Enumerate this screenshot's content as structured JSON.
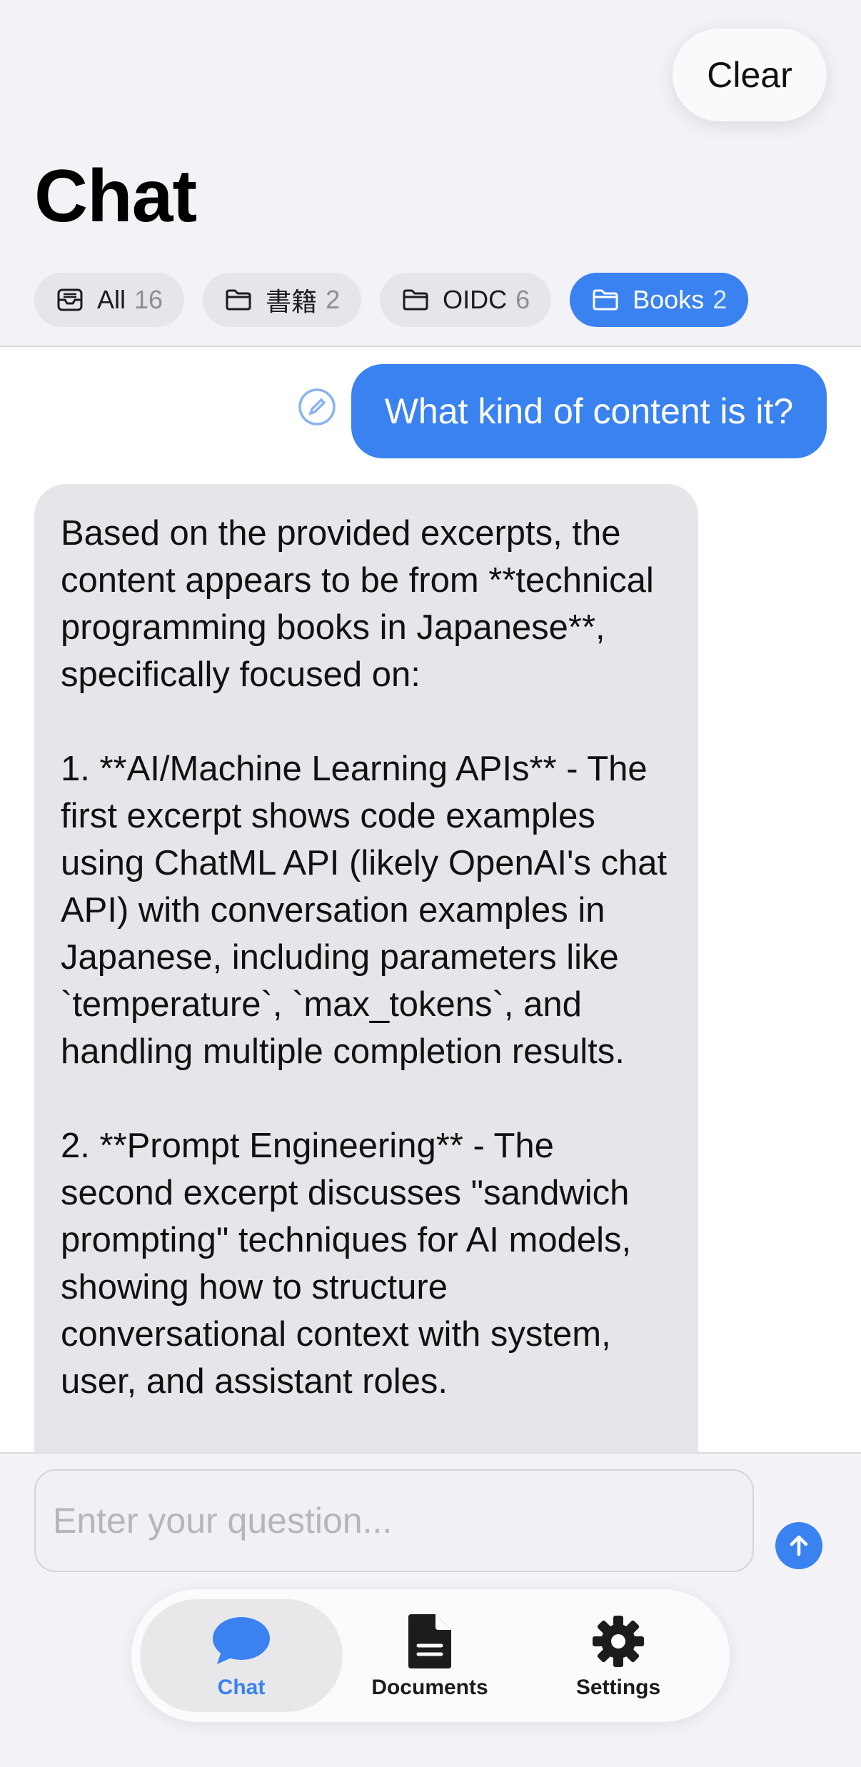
{
  "header": {
    "clear_label": "Clear",
    "title": "Chat"
  },
  "chips": [
    {
      "label": "All",
      "count": "16",
      "icon": "tray-icon",
      "active": false
    },
    {
      "label": "書籍",
      "count": "2",
      "icon": "folder-icon",
      "active": false
    },
    {
      "label": "OIDC",
      "count": "6",
      "icon": "folder-icon",
      "active": false
    },
    {
      "label": "Books",
      "count": "2",
      "icon": "folder-icon",
      "active": true
    }
  ],
  "conversation": {
    "user_message": "What kind of content is it?",
    "assistant_message": "Based on the provided excerpts, the content appears to be from **technical programming books in Japanese**, specifically focused on:\n\n1. **AI/Machine Learning APIs** - The first excerpt shows code examples using ChatML API (likely OpenAI's chat API) with conversation examples in Japanese, including parameters like `temperature`, `max_tokens`, and handling multiple completion results.\n\n2. **Prompt Engineering** - The second excerpt discusses \"sandwich prompting\" techniques for AI models, showing how to structure conversational context with system, user, and assistant roles."
  },
  "input": {
    "placeholder": "Enter your question..."
  },
  "tabs": [
    {
      "label": "Chat",
      "icon": "chat-bubble-icon",
      "active": true
    },
    {
      "label": "Documents",
      "icon": "document-icon",
      "active": false
    },
    {
      "label": "Settings",
      "icon": "gear-icon",
      "active": false
    }
  ],
  "colors": {
    "accent": "#3a82f0",
    "background": "#f2f2f7",
    "assistant_bubble": "#e5e5ea"
  }
}
